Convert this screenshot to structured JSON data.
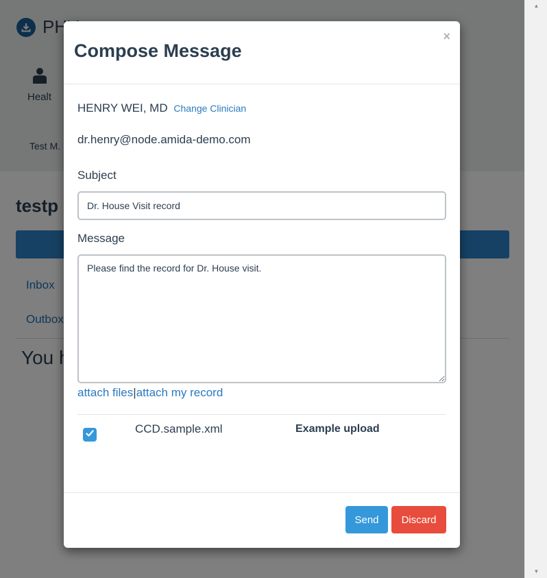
{
  "app": {
    "brand": "PHY"
  },
  "background": {
    "health_label": "Healt",
    "user_name": "Test M.",
    "page_title": "testp",
    "nav": {
      "inbox": "Inbox",
      "outbox": "Outbox"
    },
    "empty_text": "You h"
  },
  "modal": {
    "title": "Compose Message",
    "close": "×",
    "clinician": {
      "name": "HENRY WEI, MD",
      "change_label": "Change Clinician"
    },
    "email": "dr.henry@node.amida-demo.com",
    "subject": {
      "label": "Subject",
      "value": "Dr. House Visit record"
    },
    "message": {
      "label": "Message",
      "value": "Please find the record for Dr. House visit."
    },
    "attach": {
      "files_label": "attach files",
      "separator": "|",
      "record_label": "attach my record"
    },
    "attachments": [
      {
        "checked": true,
        "filename": "CCD.sample.xml",
        "description": "Example upload"
      }
    ],
    "footer": {
      "send_label": "Send",
      "discard_label": "Discard"
    }
  },
  "colors": {
    "primary": "#3498db",
    "danger": "#e74c3c",
    "link": "#2a7abf",
    "text": "#2c3e50",
    "nav_bar": "#2c82c9"
  },
  "icons": [
    "download-icon",
    "person-icon",
    "close-icon",
    "checkmark-icon",
    "scroll-up-arrow-icon",
    "scroll-down-arrow-icon"
  ]
}
